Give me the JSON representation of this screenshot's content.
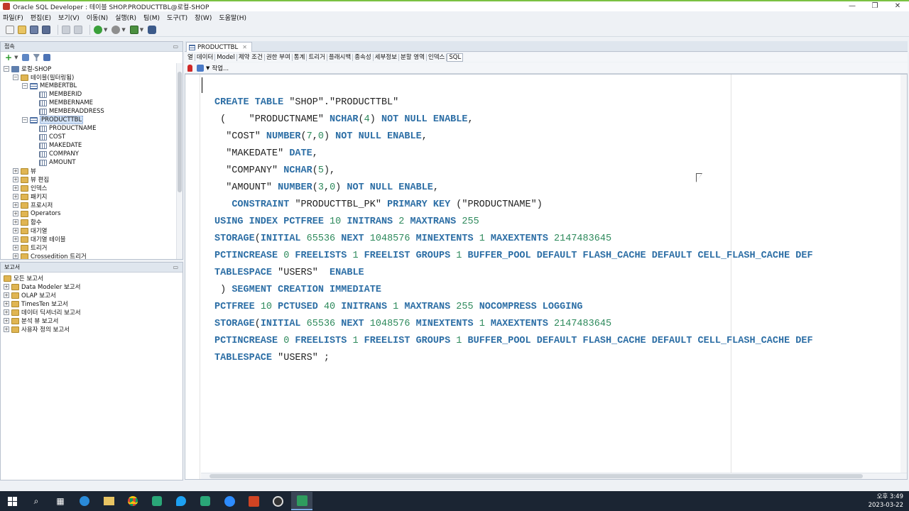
{
  "window": {
    "title": "Oracle SQL Developer : 테이블 SHOP.PRODUCTTBL@로컬-SHOP",
    "controls": [
      "—",
      "❐",
      "✕"
    ]
  },
  "menus": [
    "파일(F)",
    "편집(E)",
    "보기(V)",
    "이동(N)",
    "실행(R)",
    "팀(M)",
    "도구(T)",
    "창(W)",
    "도움말(H)"
  ],
  "connections": {
    "header": "접속",
    "tree": [
      {
        "label": "로컬-SHOP",
        "icon": "database-icon",
        "expander": "−"
      },
      {
        "label": "테이블(필터링됨)",
        "icon": "folder-icon",
        "expander": "−"
      },
      {
        "label": "MEMBERTBL",
        "icon": "table-icon",
        "expander": "−"
      },
      {
        "label": "MEMBERID",
        "icon": "column-icon",
        "expander": ""
      },
      {
        "label": "MEMBERNAME",
        "icon": "column-icon",
        "expander": ""
      },
      {
        "label": "MEMBERADDRESS",
        "icon": "column-icon",
        "expander": ""
      },
      {
        "label": "PRODUCTTBL",
        "icon": "table-icon",
        "expander": "−"
      },
      {
        "label": "PRODUCTNAME",
        "icon": "column-icon",
        "expander": ""
      },
      {
        "label": "COST",
        "icon": "column-icon",
        "expander": ""
      },
      {
        "label": "MAKEDATE",
        "icon": "column-icon",
        "expander": ""
      },
      {
        "label": "COMPANY",
        "icon": "column-icon",
        "expander": ""
      },
      {
        "label": "AMOUNT",
        "icon": "column-icon",
        "expander": ""
      },
      {
        "label": "뷰",
        "icon": "folder-icon",
        "expander": "+"
      },
      {
        "label": "뷰 편집",
        "icon": "folder-icon",
        "expander": "+"
      },
      {
        "label": "인덱스",
        "icon": "folder-icon",
        "expander": "+"
      },
      {
        "label": "패키지",
        "icon": "folder-icon",
        "expander": "+"
      },
      {
        "label": "프로시저",
        "icon": "folder-icon",
        "expander": "+"
      },
      {
        "label": "Operators",
        "icon": "folder-icon",
        "expander": "+"
      },
      {
        "label": "함수",
        "icon": "folder-icon",
        "expander": "+"
      },
      {
        "label": "대기열",
        "icon": "folder-icon",
        "expander": "+"
      },
      {
        "label": "대기열 테이블",
        "icon": "folder-icon",
        "expander": "+"
      },
      {
        "label": "트리거",
        "icon": "folder-icon",
        "expander": "+"
      },
      {
        "label": "Crossedition 트리거",
        "icon": "folder-icon",
        "expander": "+"
      }
    ]
  },
  "reports": {
    "header": "보고서",
    "tree": [
      {
        "label": "모든 보고서",
        "expander": ""
      },
      {
        "label": "Data Modeler 보고서",
        "expander": "+"
      },
      {
        "label": "OLAP 보고서",
        "expander": "+"
      },
      {
        "label": "TimesTen 보고서",
        "expander": "+"
      },
      {
        "label": "데이터 딕셔너리 보고서",
        "expander": "+"
      },
      {
        "label": "분석 뷰 보고서",
        "expander": "+"
      },
      {
        "label": "사용자 정의 보고서",
        "expander": "+"
      }
    ]
  },
  "editor": {
    "tab_label": "PRODUCTTBL",
    "subtabs": [
      "열",
      "데이터",
      "Model",
      "제약 조건",
      "권한 부여",
      "통계",
      "트리거",
      "플래시백",
      "종속성",
      "세부정보",
      "분할 영역",
      "인덱스",
      "SQL"
    ],
    "active_subtab": "SQL",
    "action_label": "작업...",
    "code_lines": [
      [
        [
          "kw",
          "CREATE TABLE "
        ],
        [
          "str",
          "\"SHOP\".\"PRODUCTTBL\""
        ]
      ],
      [
        [
          "str",
          " (    \"PRODUCTNAME\" "
        ],
        [
          "kw",
          "NCHAR"
        ],
        [
          "str",
          "("
        ],
        [
          "num",
          "4"
        ],
        [
          "str",
          ") "
        ],
        [
          "kw",
          "NOT NULL ENABLE"
        ],
        [
          "str",
          ","
        ]
      ],
      [
        [
          "str",
          "  \"COST\" "
        ],
        [
          "kw",
          "NUMBER"
        ],
        [
          "str",
          "("
        ],
        [
          "num",
          "7"
        ],
        [
          "str",
          ","
        ],
        [
          "num",
          "0"
        ],
        [
          "str",
          ") "
        ],
        [
          "kw",
          "NOT NULL ENABLE"
        ],
        [
          "str",
          ","
        ]
      ],
      [
        [
          "str",
          "  \"MAKEDATE\" "
        ],
        [
          "kw",
          "DATE"
        ],
        [
          "str",
          ","
        ]
      ],
      [
        [
          "str",
          "  \"COMPANY\" "
        ],
        [
          "kw",
          "NCHAR"
        ],
        [
          "str",
          "("
        ],
        [
          "num",
          "5"
        ],
        [
          "str",
          "),"
        ]
      ],
      [
        [
          "str",
          "  \"AMOUNT\" "
        ],
        [
          "kw",
          "NUMBER"
        ],
        [
          "str",
          "("
        ],
        [
          "num",
          "3"
        ],
        [
          "str",
          ","
        ],
        [
          "num",
          "0"
        ],
        [
          "str",
          ") "
        ],
        [
          "kw",
          "NOT NULL ENABLE"
        ],
        [
          "str",
          ","
        ]
      ],
      [
        [
          "str",
          "   "
        ],
        [
          "kw",
          "CONSTRAINT "
        ],
        [
          "str",
          "\"PRODUCTTBL_PK\" "
        ],
        [
          "kw",
          "PRIMARY KEY "
        ],
        [
          "str",
          "(\"PRODUCTNAME\")"
        ]
      ],
      [
        [
          "kw",
          "USING INDEX PCTFREE "
        ],
        [
          "num",
          "10"
        ],
        [
          "kw",
          " INITRANS "
        ],
        [
          "num",
          "2"
        ],
        [
          "kw",
          " MAXTRANS "
        ],
        [
          "num",
          "255"
        ]
      ],
      [
        [
          "kw",
          "STORAGE"
        ],
        [
          "str",
          "("
        ],
        [
          "kw",
          "INITIAL "
        ],
        [
          "num",
          "65536"
        ],
        [
          "kw",
          " NEXT "
        ],
        [
          "num",
          "1048576"
        ],
        [
          "kw",
          " MINEXTENTS "
        ],
        [
          "num",
          "1"
        ],
        [
          "kw",
          " MAXEXTENTS "
        ],
        [
          "num",
          "2147483645"
        ]
      ],
      [
        [
          "kw",
          "PCTINCREASE "
        ],
        [
          "num",
          "0"
        ],
        [
          "kw",
          " FREELISTS "
        ],
        [
          "num",
          "1"
        ],
        [
          "kw",
          " FREELIST GROUPS "
        ],
        [
          "num",
          "1"
        ],
        [
          "kw",
          " BUFFER_POOL DEFAULT FLASH_CACHE DEFAULT CELL_FLASH_CACHE DEF"
        ]
      ],
      [
        [
          "kw",
          "TABLESPACE "
        ],
        [
          "str",
          "\"USERS\"  "
        ],
        [
          "kw",
          "ENABLE"
        ]
      ],
      [
        [
          "str",
          " ) "
        ],
        [
          "kw",
          "SEGMENT CREATION IMMEDIATE"
        ]
      ],
      [
        [
          "kw",
          "PCTFREE "
        ],
        [
          "num",
          "10"
        ],
        [
          "kw",
          " PCTUSED "
        ],
        [
          "num",
          "40"
        ],
        [
          "kw",
          " INITRANS "
        ],
        [
          "num",
          "1"
        ],
        [
          "kw",
          " MAXTRANS "
        ],
        [
          "num",
          "255"
        ],
        [
          "kw",
          " NOCOMPRESS LOGGING"
        ]
      ],
      [
        [
          "kw",
          "STORAGE"
        ],
        [
          "str",
          "("
        ],
        [
          "kw",
          "INITIAL "
        ],
        [
          "num",
          "65536"
        ],
        [
          "kw",
          " NEXT "
        ],
        [
          "num",
          "1048576"
        ],
        [
          "kw",
          " MINEXTENTS "
        ],
        [
          "num",
          "1"
        ],
        [
          "kw",
          " MAXEXTENTS "
        ],
        [
          "num",
          "2147483645"
        ]
      ],
      [
        [
          "kw",
          "PCTINCREASE "
        ],
        [
          "num",
          "0"
        ],
        [
          "kw",
          " FREELISTS "
        ],
        [
          "num",
          "1"
        ],
        [
          "kw",
          " FREELIST GROUPS "
        ],
        [
          "num",
          "1"
        ],
        [
          "kw",
          " BUFFER_POOL DEFAULT FLASH_CACHE DEFAULT CELL_FLASH_CACHE DEF"
        ]
      ],
      [
        [
          "kw",
          "TABLESPACE "
        ],
        [
          "str",
          "\"USERS\" ;"
        ]
      ]
    ]
  },
  "taskbar": {
    "time": "오후 3:49",
    "date": "2023-03-22"
  }
}
